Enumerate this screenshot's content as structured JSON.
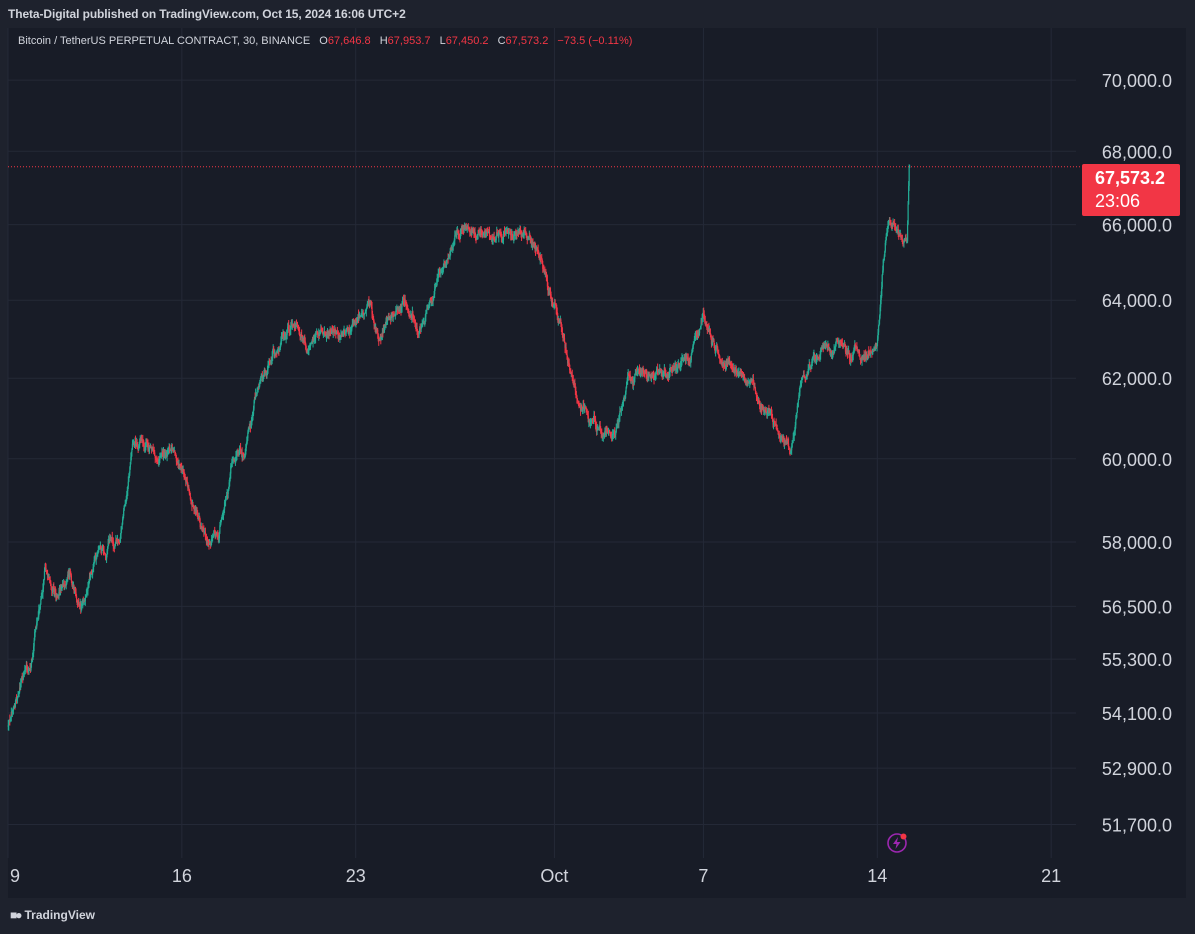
{
  "header": {
    "publisher_line": "Theta-Digital published on TradingView.com, Oct 15, 2024 16:06 UTC+2"
  },
  "legend": {
    "symbol": "Bitcoin / TetherUS PERPETUAL CONTRACT, 30, BINANCE",
    "open_key": "O",
    "open": "67,646.8",
    "high_key": "H",
    "high": "67,953.7",
    "low_key": "L",
    "low": "67,450.2",
    "close_key": "C",
    "close": "67,573.2",
    "change": "−73.5 (−0.11%)"
  },
  "price_badge": {
    "price": "67,573.2",
    "countdown": "23:06"
  },
  "footer": {
    "brand": "TradingView"
  },
  "colors": {
    "up": "#22ab94",
    "down": "#f23645",
    "background": "#181c27",
    "grid": "#242937",
    "axis_text": "#d1d4dc",
    "badge": "#f23645"
  },
  "icons": {
    "brand": "tradingview-logo-icon",
    "flash": "lightning-icon"
  },
  "chart_data": {
    "type": "candlestick",
    "symbol": "BTCUSDT.P",
    "interval": "30",
    "x_ticks": [
      "9",
      "16",
      "23",
      "Oct",
      "7",
      "14",
      "21"
    ],
    "x_tick_dates": [
      "2024-09-09",
      "2024-09-16",
      "2024-09-23",
      "2024-10-01",
      "2024-10-07",
      "2024-10-14",
      "2024-10-21"
    ],
    "y_ticks": [
      "70,000.0",
      "68,000.0",
      "66,000.0",
      "64,000.0",
      "62,000.0",
      "60,000.0",
      "58,000.0",
      "56,500.0",
      "55,300.0",
      "54,100.0",
      "52,900.0",
      "51,700.0"
    ],
    "y_tick_values": [
      70000,
      68000,
      66000,
      64000,
      62000,
      60000,
      58000,
      56500,
      55300,
      54100,
      52900,
      51700
    ],
    "y_scale": "log",
    "xlim": [
      "2024-09-09",
      "2024-10-22"
    ],
    "ylim": [
      51000,
      71500
    ],
    "grid": true,
    "last_price": 67573.2,
    "path": [
      [
        "2024-09-09",
        53800
      ],
      [
        "2024-09-10",
        55500
      ],
      [
        "2024-09-10T12",
        57200
      ],
      [
        "2024-09-11",
        56800
      ],
      [
        "2024-09-11T12",
        57400
      ],
      [
        "2024-09-12",
        56500
      ],
      [
        "2024-09-12T12",
        57600
      ],
      [
        "2024-09-13",
        57800
      ],
      [
        "2024-09-13T12",
        58000
      ],
      [
        "2024-09-14",
        60100
      ],
      [
        "2024-09-14T12",
        60300
      ],
      [
        "2024-09-15",
        59900
      ],
      [
        "2024-09-15T12",
        60200
      ],
      [
        "2024-09-16",
        59800
      ],
      [
        "2024-09-16T12",
        58700
      ],
      [
        "2024-09-17",
        58000
      ],
      [
        "2024-09-17T12",
        58300
      ],
      [
        "2024-09-18",
        59800
      ],
      [
        "2024-09-18T12",
        60200
      ],
      [
        "2024-09-19",
        61700
      ],
      [
        "2024-09-20",
        63000
      ],
      [
        "2024-09-20T12",
        63500
      ],
      [
        "2024-09-21",
        62900
      ],
      [
        "2024-09-22",
        63100
      ],
      [
        "2024-09-23",
        63300
      ],
      [
        "2024-09-23T12",
        63900
      ],
      [
        "2024-09-24",
        63200
      ],
      [
        "2024-09-25",
        64100
      ],
      [
        "2024-09-25T12",
        63200
      ],
      [
        "2024-09-26",
        64000
      ],
      [
        "2024-09-27",
        65600
      ],
      [
        "2024-09-27T12",
        66000
      ],
      [
        "2024-09-28",
        65800
      ],
      [
        "2024-09-29",
        65700
      ],
      [
        "2024-09-30",
        65800
      ],
      [
        "2024-10-01",
        63900
      ],
      [
        "2024-10-01T12",
        62700
      ],
      [
        "2024-10-02",
        61200
      ],
      [
        "2024-10-02T12",
        60900
      ],
      [
        "2024-10-03",
        60600
      ],
      [
        "2024-10-03T12",
        60800
      ],
      [
        "2024-10-04",
        62000
      ],
      [
        "2024-10-05",
        62200
      ],
      [
        "2024-10-06",
        62400
      ],
      [
        "2024-10-06T12",
        62400
      ],
      [
        "2024-10-07",
        63700
      ],
      [
        "2024-10-07T12",
        62900
      ],
      [
        "2024-10-08",
        62300
      ],
      [
        "2024-10-08T12",
        62200
      ],
      [
        "2024-10-09",
        61800
      ],
      [
        "2024-10-10",
        60600
      ],
      [
        "2024-10-10T12",
        60000
      ],
      [
        "2024-10-11",
        62000
      ],
      [
        "2024-10-12",
        62900
      ],
      [
        "2024-10-12T12",
        62700
      ],
      [
        "2024-10-13",
        62500
      ],
      [
        "2024-10-14",
        62700
      ],
      [
        "2024-10-14T06",
        65000
      ],
      [
        "2024-10-14T12",
        66100
      ],
      [
        "2024-10-14T18",
        65800
      ],
      [
        "2024-10-15T05",
        65700
      ],
      [
        "2024-10-15T07",
        67573.2
      ]
    ]
  }
}
